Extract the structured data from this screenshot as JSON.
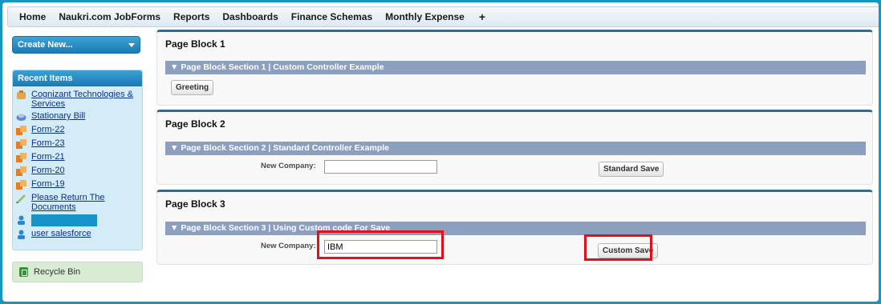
{
  "tabs": [
    "Home",
    "Naukri.com JobForms",
    "Reports",
    "Dashboards",
    "Finance Schemas",
    "Monthly Expense"
  ],
  "tab_add": "+",
  "sidebar": {
    "create_new": "Create New...",
    "recent_title": "Recent Items",
    "recent_items": [
      {
        "label": "Cognizant Technologies & Services",
        "icon": "account-icon"
      },
      {
        "label": "Stationary Bill",
        "icon": "bill-icon"
      },
      {
        "label": "Form-22",
        "icon": "form-icon"
      },
      {
        "label": "Form-23",
        "icon": "form-icon"
      },
      {
        "label": "Form-21",
        "icon": "form-icon"
      },
      {
        "label": "Form-20",
        "icon": "form-icon"
      },
      {
        "label": "Form-19",
        "icon": "form-icon"
      },
      {
        "label": "Please Return The Documents",
        "icon": "note-icon"
      },
      {
        "label": "",
        "icon": "user-icon"
      },
      {
        "label": "user salesforce",
        "icon": "user-icon"
      }
    ],
    "recycle_bin": "Recycle Bin"
  },
  "blocks": [
    {
      "title": "Page Block 1",
      "section": "Page Block Section 1 | Custom Controller Example",
      "button": "Greeting"
    },
    {
      "title": "Page Block 2",
      "section": "Page Block Section 2 | Standard Controller Example",
      "label": "New Company:",
      "value": "",
      "button": "Standard Save"
    },
    {
      "title": "Page Block 3",
      "section": "Page Block Section 3 | Using Custom code For Save",
      "label": "New Company:",
      "value": "IBM",
      "button": "Custom Save"
    }
  ],
  "colors": {
    "accent": "#1f6fa8",
    "section": "#8d9fbe",
    "highlight": "#e0101d",
    "background": "#1797c0"
  }
}
